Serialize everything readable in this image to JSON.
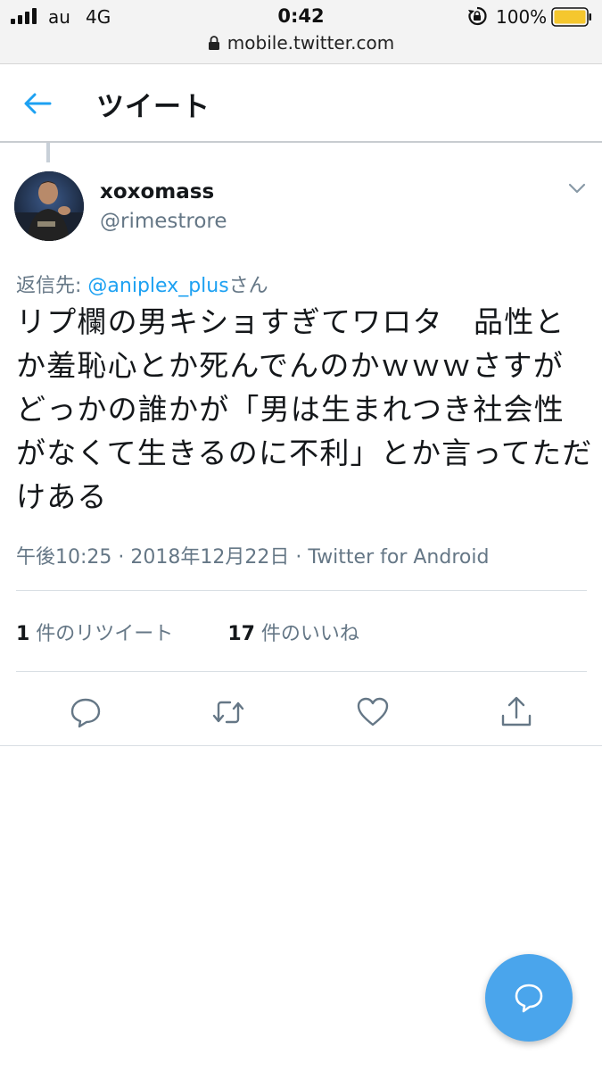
{
  "status_bar": {
    "carrier": "au",
    "network": "4G",
    "time": "0:42",
    "battery": "100%"
  },
  "url_bar": {
    "url": "mobile.twitter.com"
  },
  "header": {
    "title": "ツイート"
  },
  "tweet": {
    "display_name": "xoxomass",
    "username": "@rimestrore",
    "reply_prefix": "返信先: ",
    "reply_mention": "@aniplex_plus",
    "reply_suffix": "さん",
    "text": "リプ欄の男キショすぎてワロタ　品性とか羞恥心とか死んでんのかｗｗｗさすがどっかの誰かが「男は生まれつき社会性がなくて生きるのに不利」とか言ってただけある",
    "time": "午後10:25",
    "date": "2018年12月22日",
    "separator": "·",
    "source": "Twitter for Android",
    "retweet_count": "1",
    "retweet_label": " 件のリツイート",
    "like_count": "17",
    "like_label": " 件のいいね"
  },
  "icons": {
    "back": "back-arrow-icon",
    "caret": "chevron-down-icon",
    "reply": "reply-icon",
    "retweet": "retweet-icon",
    "like": "heart-icon",
    "share": "share-icon",
    "compose": "compose-reply-icon"
  },
  "colors": {
    "accent": "#1da1f2",
    "secondary_text": "#657786",
    "fab": "#4aa5ec",
    "battery": "#f5c72e"
  }
}
